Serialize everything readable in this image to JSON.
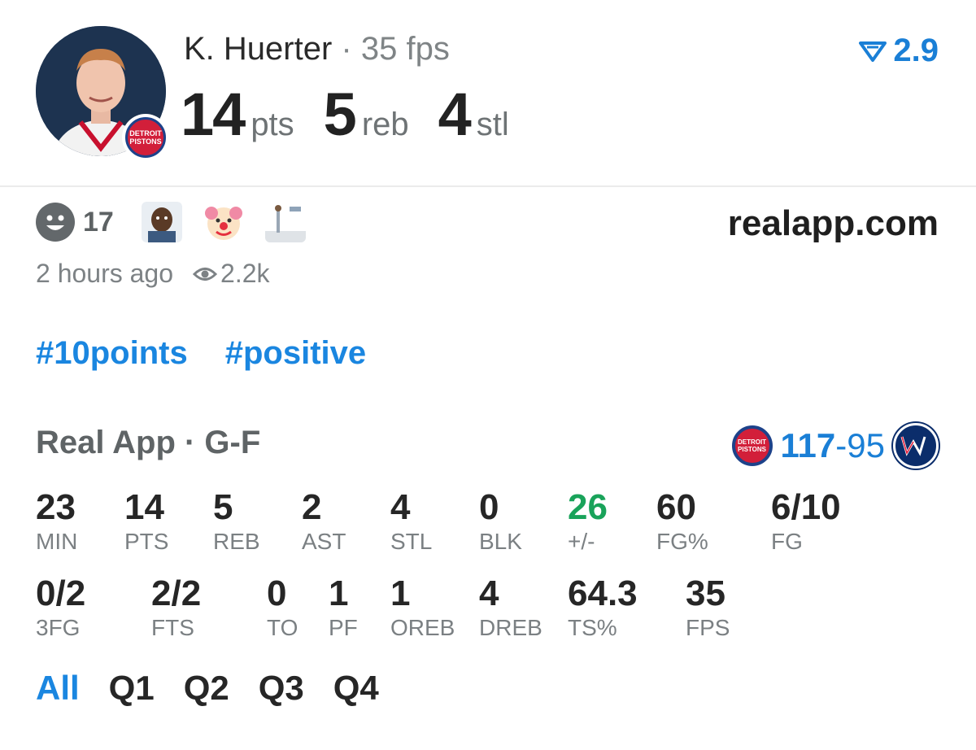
{
  "header": {
    "player_name": "K. Huerter",
    "separator": "·",
    "fps_text": "35 fps",
    "stats": [
      {
        "value": "14",
        "unit": "pts"
      },
      {
        "value": "5",
        "unit": "reb"
      },
      {
        "value": "4",
        "unit": "stl"
      }
    ],
    "rating": "2.9",
    "team_badge": "DETROIT PISTONS"
  },
  "reactions": {
    "count": "17",
    "site": "realapp.com",
    "time_ago": "2 hours ago",
    "views": "2.2k"
  },
  "tags": [
    "#10points",
    "#positive"
  ],
  "game": {
    "title": "Real App · G-F",
    "home_score": "117",
    "score_sep": "-",
    "away_score": "95",
    "home_logo_text": "DETROIT PISTONS"
  },
  "stats_row1": [
    {
      "value": "23",
      "label": "MIN"
    },
    {
      "value": "14",
      "label": "PTS"
    },
    {
      "value": "5",
      "label": "REB"
    },
    {
      "value": "2",
      "label": "AST"
    },
    {
      "value": "4",
      "label": "STL"
    },
    {
      "value": "0",
      "label": "BLK"
    },
    {
      "value": "26",
      "label": "+/-"
    },
    {
      "value": "60",
      "label": "FG%"
    },
    {
      "value": "6/10",
      "label": "FG"
    }
  ],
  "stats_row2": [
    {
      "value": "0/2",
      "label": "3FG"
    },
    {
      "value": "2/2",
      "label": "FTS"
    },
    {
      "value": "0",
      "label": "TO"
    },
    {
      "value": "1",
      "label": "PF"
    },
    {
      "value": "1",
      "label": "OREB"
    },
    {
      "value": "4",
      "label": "DREB"
    },
    {
      "value": "64.3",
      "label": "TS%"
    },
    {
      "value": "35",
      "label": "FPS"
    }
  ],
  "quarters": [
    "All",
    "Q1",
    "Q2",
    "Q3",
    "Q4"
  ],
  "colors": {
    "accent": "#1a86e0",
    "positive": "#19a35a",
    "muted": "#7b8083"
  }
}
